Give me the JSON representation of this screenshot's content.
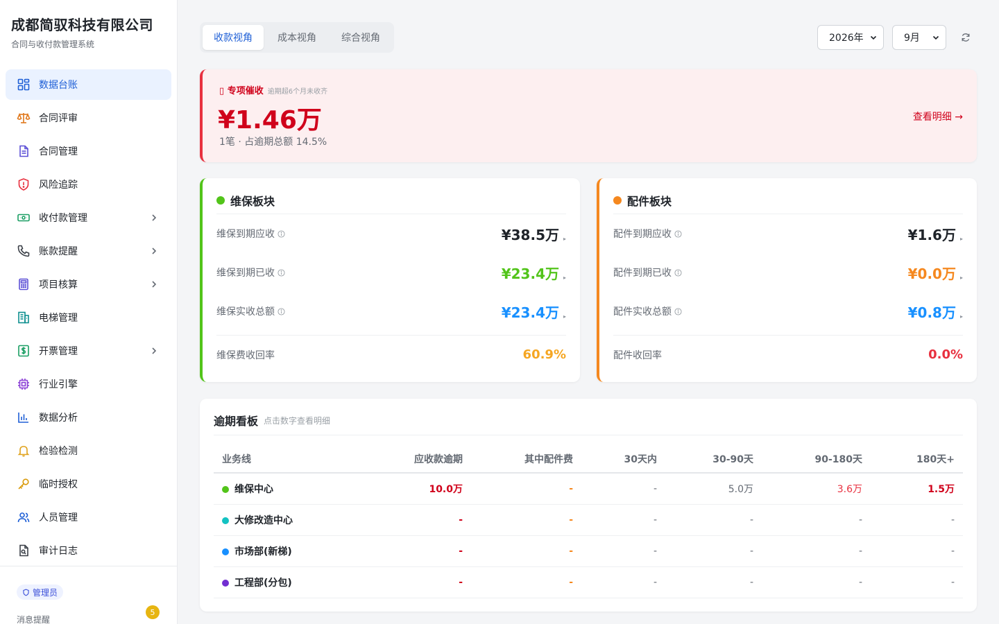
{
  "brand": {
    "title": "成都简驭科技有限公司",
    "subtitle": "合同与收付款管理系统"
  },
  "sidebar": {
    "items": [
      {
        "label": "数据台账",
        "icon": "dashboard-icon"
      },
      {
        "label": "合同评审",
        "icon": "scale-icon"
      },
      {
        "label": "合同管理",
        "icon": "document-icon"
      },
      {
        "label": "风险追踪",
        "icon": "shield-alert-icon"
      },
      {
        "label": "收付款管理",
        "icon": "cash-icon"
      },
      {
        "label": "账款提醒",
        "icon": "phone-icon"
      },
      {
        "label": "项目核算",
        "icon": "calculator-icon"
      },
      {
        "label": "电梯管理",
        "icon": "building-icon"
      },
      {
        "label": "开票管理",
        "icon": "invoice-icon"
      },
      {
        "label": "行业引擎",
        "icon": "chip-icon"
      },
      {
        "label": "数据分析",
        "icon": "bar-chart-icon"
      },
      {
        "label": "检验检测",
        "icon": "bell-icon"
      },
      {
        "label": "临时授权",
        "icon": "key-icon"
      },
      {
        "label": "人员管理",
        "icon": "users-icon"
      },
      {
        "label": "审计日志",
        "icon": "audit-file-icon"
      }
    ],
    "role": "管理员",
    "messages_label": "消息提醒",
    "messages_count": "5"
  },
  "tabs": [
    {
      "label": "收款视角"
    },
    {
      "label": "成本视角"
    },
    {
      "label": "综合视角"
    }
  ],
  "filters": {
    "year": "2026年",
    "month": "9月"
  },
  "alert": {
    "tag": "专项催收",
    "note": "逾期超6个月未收齐",
    "amount": "¥1.46万",
    "meta": "1笔 · 占逾期总额 14.5%",
    "link": "查看明细 →"
  },
  "segments": {
    "maintenance": {
      "title": "维保板块",
      "rows": [
        {
          "label": "维保到期应收",
          "value": "¥38.5万",
          "color": "#1f2329"
        },
        {
          "label": "维保到期已收",
          "value": "¥23.4万",
          "color": "#52c41a"
        },
        {
          "label": "维保实收总额",
          "value": "¥23.4万",
          "color": "#1890ff"
        }
      ],
      "rate_label": "维保费收回率",
      "rate": "60.9%",
      "rate_color": "#f5a623"
    },
    "parts": {
      "title": "配件板块",
      "rows": [
        {
          "label": "配件到期应收",
          "value": "¥1.6万",
          "color": "#1f2329"
        },
        {
          "label": "配件到期已收",
          "value": "¥0.0万",
          "color": "#f5881f"
        },
        {
          "label": "配件实收总额",
          "value": "¥0.8万",
          "color": "#1890ff"
        }
      ],
      "rate_label": "配件收回率",
      "rate": "0.0%",
      "rate_color": "#e8303f"
    }
  },
  "board": {
    "title": "逾期看板",
    "subtitle": "点击数字查看明细",
    "columns": [
      "业务线",
      "应收款逾期",
      "其中配件费",
      "30天内",
      "30-90天",
      "90-180天",
      "180天+"
    ],
    "rows": [
      {
        "name": "维保中心",
        "dot": "#52c41a",
        "cells": [
          "10.0万",
          "-",
          "-",
          "5.0万",
          "3.6万",
          "1.5万"
        ]
      },
      {
        "name": "大修改造中心",
        "dot": "#13c2c2",
        "cells": [
          "-",
          "-",
          "-",
          "-",
          "-",
          "-"
        ]
      },
      {
        "name": "市场部(新梯)",
        "dot": "#1890ff",
        "cells": [
          "-",
          "-",
          "-",
          "-",
          "-",
          "-"
        ]
      },
      {
        "name": "工程部(分包)",
        "dot": "#722ed1",
        "cells": [
          "-",
          "-",
          "-",
          "-",
          "-",
          "-"
        ]
      }
    ]
  }
}
